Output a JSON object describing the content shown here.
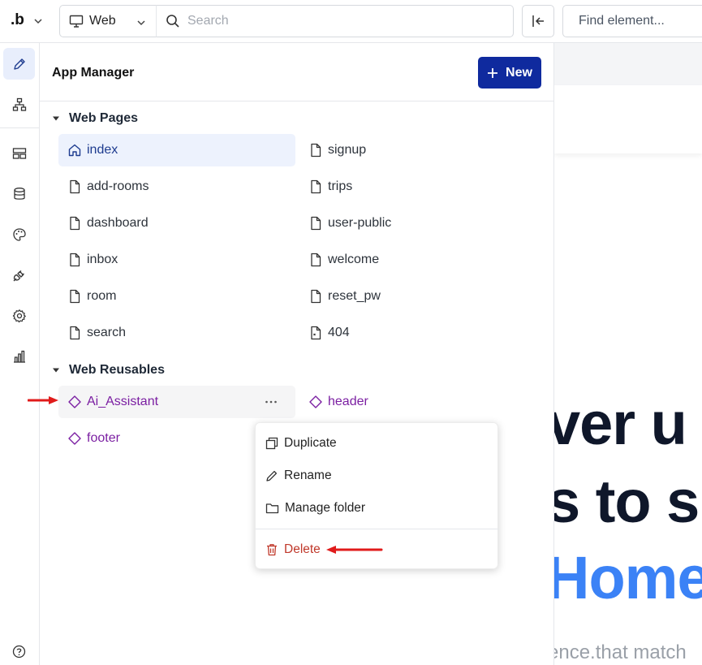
{
  "topbar": {
    "logo": ".b",
    "device": "Web",
    "search_placeholder": "Search",
    "find_placeholder": "Find element..."
  },
  "rail": {
    "items": [
      "design-icon",
      "element-tree-icon",
      "layout-icon",
      "database-icon",
      "styles-icon",
      "plugins-icon",
      "settings-icon",
      "logs-icon"
    ],
    "help": "help-icon"
  },
  "panel": {
    "title": "App Manager",
    "new_label": "New",
    "web_pages": {
      "title": "Web Pages",
      "left": [
        "index",
        "add-rooms",
        "dashboard",
        "inbox",
        "room",
        "search"
      ],
      "right": [
        "signup",
        "trips",
        "user-public",
        "welcome",
        "reset_pw",
        "404"
      ]
    },
    "web_reusables": {
      "title": "Web Reusables",
      "items": [
        "Ai_Assistant",
        "header",
        "footer"
      ]
    }
  },
  "context_menu": {
    "items": [
      "Duplicate",
      "Rename",
      "Manage folder"
    ],
    "delete": "Delete"
  },
  "canvas": {
    "hero_line1": "ver u",
    "hero_line2": "s to s",
    "hero_line3": "Home",
    "sub": "ence.that match"
  },
  "colors": {
    "primary": "#0f2a9e",
    "reusable": "#7b1fa2",
    "danger": "#c0392b",
    "annotation": "#e01b1b",
    "hero_blue": "#3b82f6"
  }
}
